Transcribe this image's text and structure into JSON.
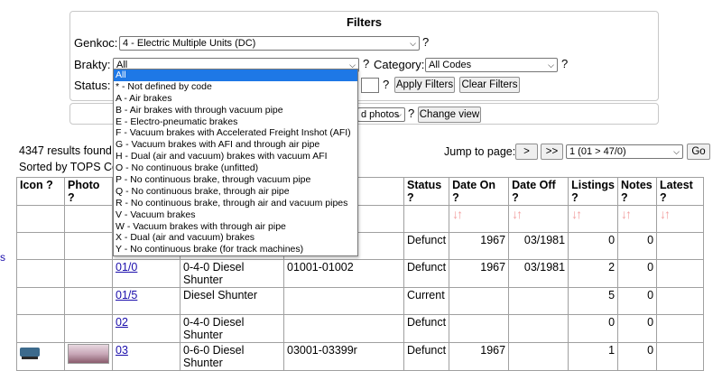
{
  "filters": {
    "title": "Filters",
    "genkoc_label": "Genkoc:",
    "genkoc_value": "4 - Electric Multiple Units (DC)",
    "brakty_label": "Brakty:",
    "brakty_value": "All",
    "category_label": "Category:",
    "category_value": "All Codes",
    "status_label": "Status:",
    "help": "?",
    "apply_button": "Apply Filters",
    "clear_button": "Clear Filters"
  },
  "view": {
    "photos_select": "d photos",
    "change_view_button": "Change view",
    "help": "?"
  },
  "brake_options": [
    "All",
    "* - Not defined by code",
    "A - Air brakes",
    "B - Air brakes with through vacuum pipe",
    "E - Electro-pneumatic brakes",
    "F - Vacuum brakes with Accelerated Freight Inshot (AFI)",
    "G - Vacuum brakes with AFI and through air pipe",
    "H - Dual (air and vacuum) brakes with vacuum AFI",
    "O - No continuous brake (unfitted)",
    "P - No continuous brake, through vacuum pipe",
    "Q - No continuous brake, through air pipe",
    "R - No continuous brake, through air and vacuum pipes",
    "V - Vacuum brakes",
    "W - Vacuum brakes with through air pipe",
    "X - Dual (air and vacuum) brakes",
    "Y - No continuous brake (for track machines)"
  ],
  "results": {
    "count_text": "4347 results found",
    "sorted_text": "Sorted by TOPS Co",
    "jump_label": "Jump to page:",
    "next_button": ">",
    "last_button": ">>",
    "page_select": "1 (01 > 47/0)",
    "go_button": "Go"
  },
  "left_link": "s",
  "table": {
    "headers": {
      "icon": "Icon ?",
      "photo": "Photo ?",
      "status": "Status ?",
      "date_on": "Date On ?",
      "date_off": "Date Off ?",
      "listings": "Listings ?",
      "notes": "Notes ?",
      "latest": "Latest ?"
    },
    "rows": [
      {
        "code": "",
        "desc": "",
        "numbers": "",
        "status": "Defunct",
        "date_on": "1967",
        "date_off": "03/1981",
        "listings": "0",
        "notes": "0"
      },
      {
        "code": "01/0",
        "desc": "0-4-0 Diesel Shunter",
        "numbers": "01001-01002",
        "status": "Defunct",
        "date_on": "1967",
        "date_off": "03/1981",
        "listings": "2",
        "notes": "0"
      },
      {
        "code": "01/5",
        "desc": "Diesel Shunter",
        "numbers": "",
        "status": "Current",
        "date_on": "",
        "date_off": "",
        "listings": "5",
        "notes": "0"
      },
      {
        "code": "02",
        "desc": "0-4-0 Diesel Shunter",
        "numbers": "",
        "status": "Defunct",
        "date_on": "",
        "date_off": "",
        "listings": "0",
        "notes": "0"
      },
      {
        "code": "03",
        "desc": "0-6-0 Diesel Shunter",
        "numbers": "03001-03399r",
        "status": "Defunct",
        "date_on": "1967",
        "date_off": "",
        "listings": "1",
        "notes": "0"
      }
    ]
  }
}
